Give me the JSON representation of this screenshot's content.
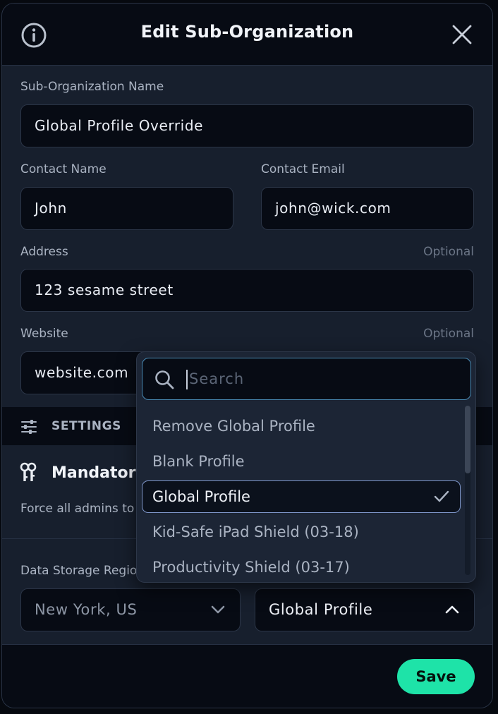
{
  "header": {
    "title": "Edit Sub-Organization",
    "info_icon": "info-icon",
    "close_icon": "close-icon"
  },
  "form": {
    "sub_org_name": {
      "label": "Sub-Organization Name",
      "value": "Global Profile Override"
    },
    "contact_name": {
      "label": "Contact Name",
      "value": "John"
    },
    "contact_email": {
      "label": "Contact Email",
      "value": "john@wick.com"
    },
    "address": {
      "label": "Address",
      "optional": "Optional",
      "value": "123 sesame street"
    },
    "website": {
      "label": "Website",
      "optional": "Optional",
      "value": "website.com"
    }
  },
  "settings": {
    "section_label": "SETTINGS",
    "mandatory_title": "Mandatory",
    "force_text": "Force all admins to",
    "data_storage_label": "Data Storage Regio",
    "data_storage_value": "New York, US",
    "profile_value": "Global Profile"
  },
  "dropdown": {
    "search_placeholder": "Search",
    "options": [
      {
        "label": "Remove Global Profile"
      },
      {
        "label": "Blank Profile"
      },
      {
        "label": "Global Profile",
        "selected": true
      },
      {
        "label": "Kid-Safe iPad Shield (03-18)"
      },
      {
        "label": "Productivity Shield (03-17)"
      }
    ]
  },
  "footer": {
    "save_label": "Save"
  },
  "colors": {
    "accent": "#1ee3a8",
    "panel": "#171f2d",
    "input_bg": "#070b14",
    "focus_border": "#4a8bb5"
  }
}
